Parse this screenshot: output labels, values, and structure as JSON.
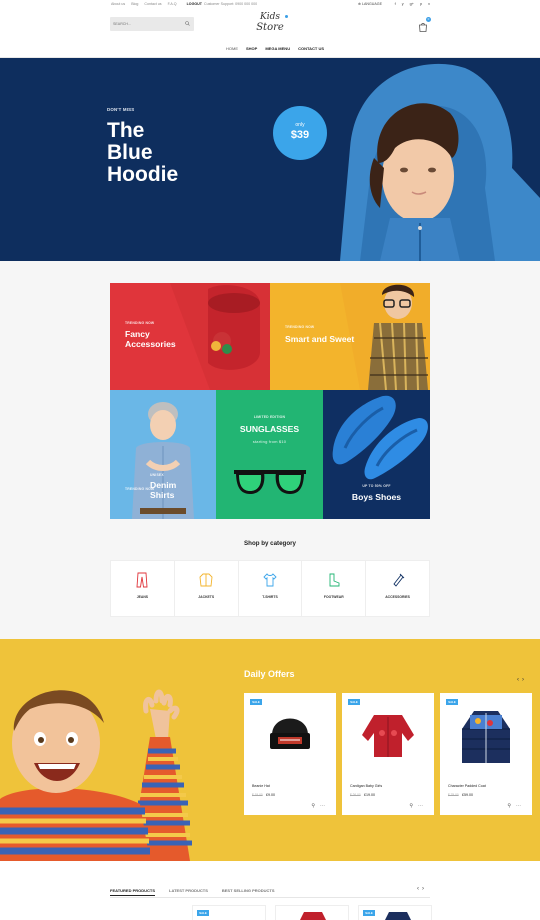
{
  "topbar": {
    "links": [
      "About us",
      "Blog",
      "Contact us",
      "F.A.Q",
      "LOGOUT"
    ],
    "support": "Customer Support: 0900 000 000",
    "language": "LANGUAGE",
    "social": [
      "f",
      "y",
      "g+",
      "p",
      "v"
    ]
  },
  "header": {
    "search_placeholder": "SEARCH...",
    "logo_line1": "Kids",
    "logo_line2": "Store",
    "cart_count": "0",
    "nav": [
      "HOME",
      "SHOP",
      "MEGA MENU",
      "CONTACT US"
    ]
  },
  "hero": {
    "eyebrow": "DON'T MISS",
    "title": "The\nBlue\nHoodie",
    "price_label": "only",
    "price": "$39",
    "bg_color": "#0e2e5e",
    "accent": "#3ba5ea"
  },
  "promos": {
    "t1_small": "TRENDING NOW",
    "t1_big": "Fancy\nAccessories",
    "t2_small": "TRENDING NOW",
    "t2_big": "Smart and Sweet",
    "t3_small": "TRENDING NOW",
    "t3_unisex": "UNISEX",
    "t3_big": "Denim\nShirts",
    "t4_small": "LIMITED EDITION",
    "t4_big": "SUNGLASSES",
    "t4_sub": "starting from $10",
    "t5_small": "UP TO 50% OFF",
    "t5_big": "Boys Shoes"
  },
  "categories": {
    "title": "Shop by category",
    "items": [
      {
        "label": "JEANS",
        "icon": "jeans-icon"
      },
      {
        "label": "JACKETS",
        "icon": "jacket-icon"
      },
      {
        "label": "T-SHIRTS",
        "icon": "tshirt-icon"
      },
      {
        "label": "FOOTWEAR",
        "icon": "boot-icon"
      },
      {
        "label": "ACCESSORIES",
        "icon": "tie-icon"
      }
    ]
  },
  "offers": {
    "title": "Daily Offers",
    "bg_color": "#efc33a",
    "products": [
      {
        "tag": "SALE",
        "name": "Beanie Hat",
        "old_price": "$ 19.00",
        "price": "£9.00"
      },
      {
        "tag": "SALE",
        "name": "Cardigan Baby Girls",
        "old_price": "$ 26.00",
        "price": "£19.00"
      },
      {
        "tag": "SALE",
        "name": "Character Padded Coat",
        "old_price": "$ 79.00",
        "price": "£59.00"
      }
    ]
  },
  "tabs": {
    "items": [
      "FEATURED PRODUCTS",
      "LATEST PRODUCTS",
      "BEST SELLING PRODUCTS"
    ],
    "strip_tag": "SALE"
  }
}
